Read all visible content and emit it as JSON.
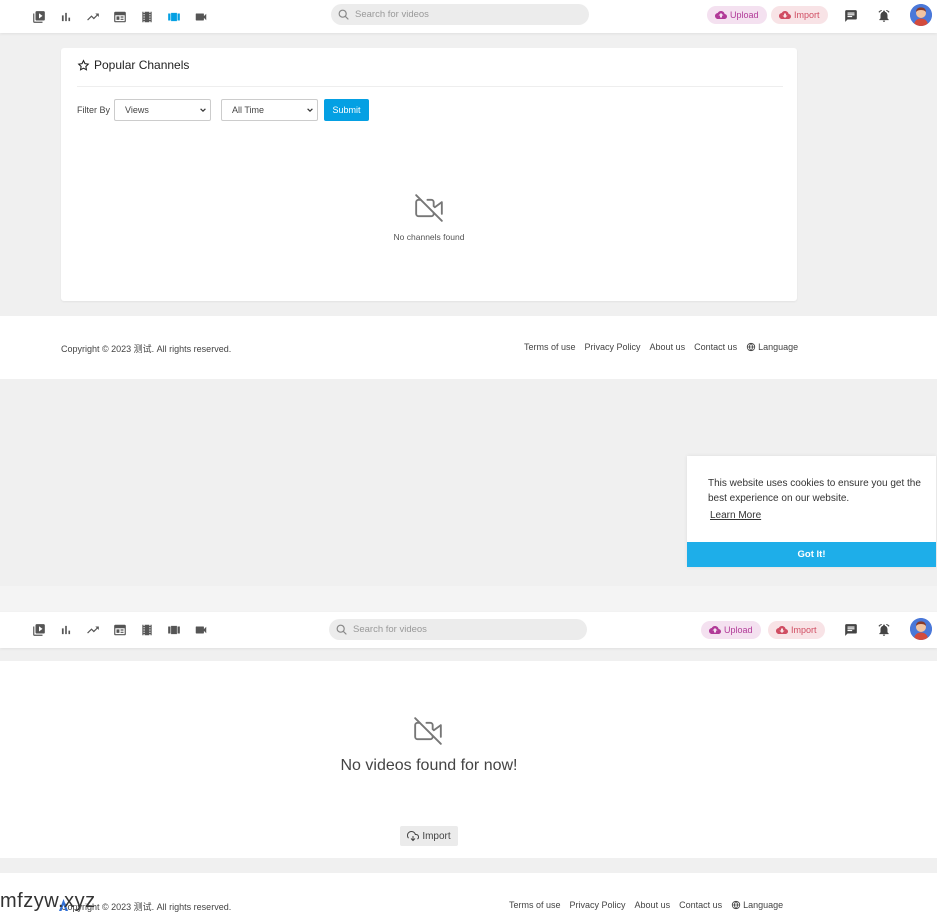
{
  "header": {
    "search_placeholder": "Search for videos",
    "upload_label": "Upload",
    "import_label": "Import"
  },
  "popular": {
    "title": "Popular Channels",
    "filter_label": "Filter By",
    "filter_value": "Views",
    "time_value": "All Time",
    "submit_label": "Submit",
    "empty_text": "No channels found"
  },
  "footer": {
    "copyright": "Copyright © 2023 测试. All rights reserved.",
    "links": [
      "Terms of use",
      "Privacy Policy",
      "About us",
      "Contact us"
    ],
    "language_label": "Language"
  },
  "cookie": {
    "message": "This website uses cookies to ensure you get the best experience on our website.",
    "learn_more": "Learn More",
    "accept": "Got It!"
  },
  "videos": {
    "empty_text": "No videos found for now!",
    "import_label": "Import"
  },
  "watermark": {
    "text": "mfzyw.xyz"
  },
  "colors": {
    "accent": "#04a0e3",
    "upload_bg": "#f4e1f0",
    "import_bg": "#f8e3e6",
    "cookie_button": "#1eaee9"
  }
}
